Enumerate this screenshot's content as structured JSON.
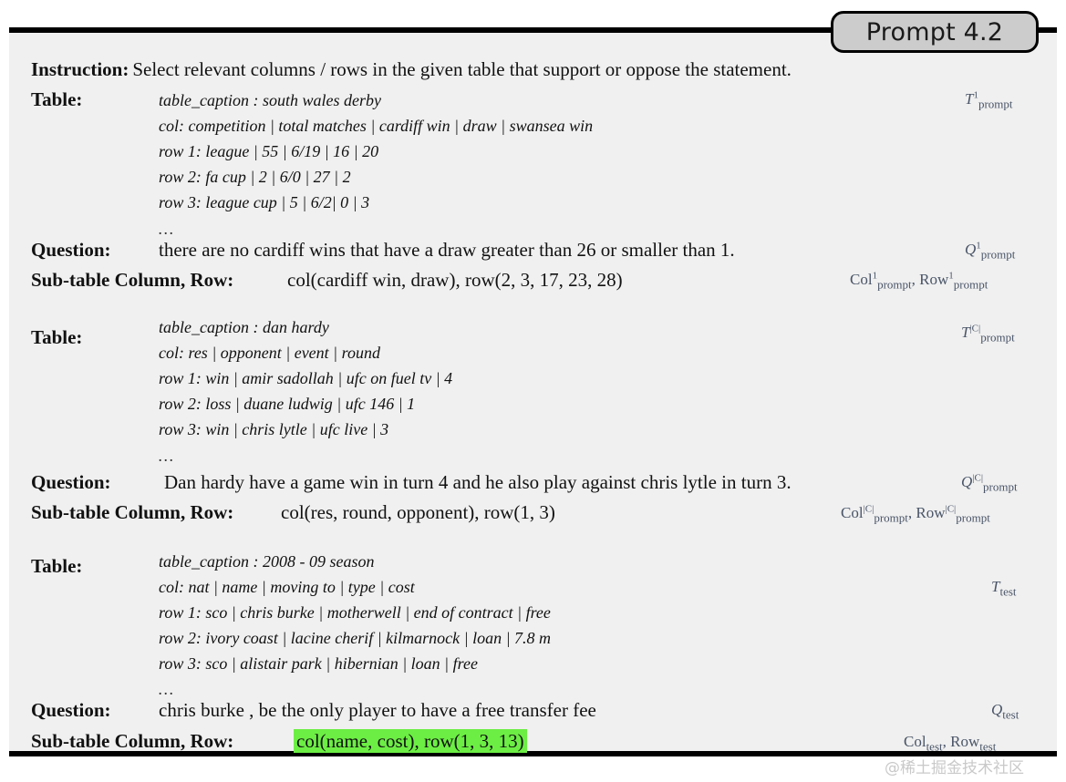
{
  "tab": {
    "label": "Prompt 4.2"
  },
  "colors": {
    "panel_bg": "#f0f0f0",
    "rule": "#000000",
    "tab_bg": "#cccccc",
    "highlight": "#6cee44",
    "annotation": "#4a5568",
    "watermark": "#c9c9c9"
  },
  "labels": {
    "instruction": "Instruction",
    "table": "Table",
    "question": "Question",
    "subtable": "Sub-table Column, Row",
    "colon": ":",
    "ellipsis": "…"
  },
  "instruction": {
    "label": "Instruction:",
    "text": "Select relevant columns / rows in the given table that support or oppose the statement."
  },
  "blocks": [
    {
      "table_label": "Table:",
      "table_lines": [
        "table_caption : south wales derby",
        "col: competition  |  total matches  |  cardiff win  |  draw  |  swansea win",
        "row 1: league  |  55  |  6/19  |  16  |  20",
        "row 2: fa cup  |  2  |  6/0  |  27  |  2",
        "row 3: league cup  |  5  |  6/2|  0  |  3"
      ],
      "ellipsis": "…",
      "question_label": "Question:",
      "question_text": "there are no cardiff wins that have a draw greater than 26 or smaller than 1.",
      "subtable_label": "Sub-table Column, Row:",
      "subtable_text": "col(cardiff win,  draw), row(2, 3, 17,  23, 28)",
      "subtable_highlight": false,
      "annot_table": {
        "sym": "T",
        "sup": "1",
        "sub": "prompt"
      },
      "annot_question": {
        "sym": "Q",
        "sup": "1",
        "sub": "prompt"
      },
      "annot_subtable": [
        {
          "sym": "Col",
          "sup": "1",
          "sub": "prompt",
          "upright": true
        },
        {
          "sym": "Row",
          "sup": "1",
          "sub": "prompt",
          "upright": true
        }
      ]
    },
    {
      "table_label": "Table:",
      "table_lines": [
        "table_caption : dan hardy",
        "col: res  |  opponent  |  event  |  round",
        "row 1: win  |  amir sadollah  |  ufc on fuel tv  |  4",
        "row 2: loss  |  duane ludwig  |  ufc 146  |  1",
        "row 3: win  |  chris lytle  |  ufc live  |  3"
      ],
      "ellipsis": "…",
      "question_label": "Question:",
      "question_text": "Dan hardy have a game win in turn 4 and he also play against chris lytle in turn 3.",
      "subtable_label": "Sub-table Column, Row:",
      "subtable_text": "col(res, round, opponent), row(1, 3)",
      "subtable_highlight": false,
      "annot_table": {
        "sym": "T",
        "sup": "|C|",
        "sub": "prompt"
      },
      "annot_question": {
        "sym": "Q",
        "sup": "|C|",
        "sub": "prompt"
      },
      "annot_subtable": [
        {
          "sym": "Col",
          "sup": "|C|",
          "sub": "prompt",
          "upright": true
        },
        {
          "sym": "Row",
          "sup": "|C|",
          "sub": "prompt",
          "upright": true
        }
      ]
    },
    {
      "table_label": "Table:",
      "table_lines": [
        "table_caption : 2008 - 09 season",
        "col: nat  |  name  |  moving to  |  type  |  cost",
        "row 1: sco  |  chris burke  |  motherwell  |  end of contract  |  free",
        "row 2: ivory coast  |  lacine cherif  |  kilmarnock  |  loan  |  7.8 m",
        "row 3: sco  |  alistair park  |  hibernian  |  loan  |  free"
      ],
      "ellipsis": "…",
      "question_label": "Question:",
      "question_text": "chris burke , be the only player to have a free transfer fee",
      "subtable_label": "Sub-table Column, Row:",
      "subtable_text": "col(name, cost), row(1, 3, 13)",
      "subtable_highlight": true,
      "annot_table": {
        "sym": "T",
        "sup": "",
        "sub": "test"
      },
      "annot_question": {
        "sym": "Q",
        "sup": "",
        "sub": "test"
      },
      "annot_subtable": [
        {
          "sym": "Col",
          "sup": "",
          "sub": "test",
          "upright": true
        },
        {
          "sym": "Row",
          "sup": "",
          "sub": "test",
          "upright": true
        }
      ]
    }
  ],
  "watermark": {
    "text": "@稀土掘金技术社区"
  }
}
